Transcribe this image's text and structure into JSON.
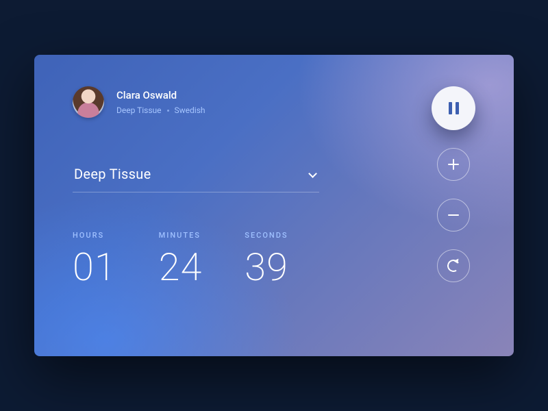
{
  "user": {
    "name": "Clara Oswald",
    "tags": [
      "Deep Tissue",
      "Swedish"
    ]
  },
  "selector": {
    "selected": "Deep Tissue"
  },
  "timer": {
    "hours": {
      "label": "HOURS",
      "value": "01"
    },
    "minutes": {
      "label": "MINUTES",
      "value": "24"
    },
    "seconds": {
      "label": "SECONDS",
      "value": "39"
    }
  },
  "controls": {
    "pause": "pause-icon",
    "add": "plus-icon",
    "subtract": "minus-icon",
    "reset": "reset-icon"
  }
}
